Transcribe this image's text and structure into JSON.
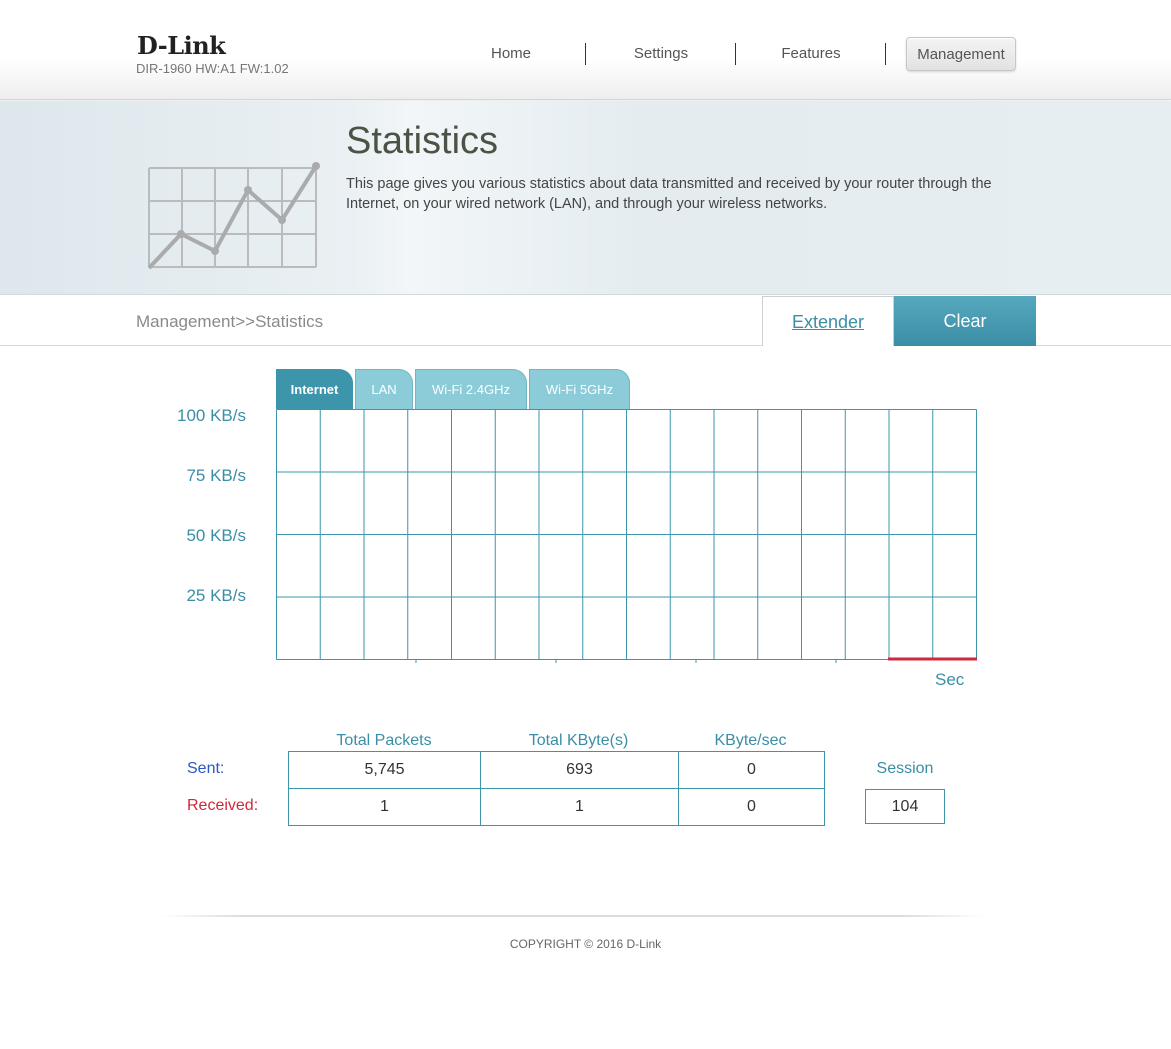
{
  "header": {
    "logo": "D-Link",
    "model": "DIR-1960 HW:A1 FW:1.02",
    "nav": [
      "Home",
      "Settings",
      "Features",
      "Management"
    ],
    "active_nav": "Management"
  },
  "banner": {
    "title": "Statistics",
    "description": "This page gives you various statistics about data transmitted and received by your router through the Internet, on your wired network (LAN), and through your wireless networks.",
    "icon": "line-chart-illustration"
  },
  "breadcrumb": "Management>>Statistics",
  "buttons": {
    "extender": "Extender",
    "clear": "Clear"
  },
  "tabs": [
    "Internet",
    "LAN",
    "Wi-Fi 2.4GHz",
    "Wi-Fi 5GHz"
  ],
  "active_tab": "Internet",
  "graph": {
    "y_labels": [
      "100 KB/s",
      "75 KB/s",
      "50 KB/s",
      "25 KB/s"
    ],
    "x_label": "Sec",
    "grid_color": "#3d95ab",
    "sent_color": "#2b59c3",
    "received_color": "#d1283b",
    "received_trace": "flat at 0 KB/s over the last two intervals"
  },
  "stats": {
    "columns": [
      "Total Packets",
      "Total KByte(s)",
      "KByte/sec"
    ],
    "sent_label": "Sent:",
    "received_label": "Received:",
    "sent": [
      "5,745",
      "693",
      "0"
    ],
    "received": [
      "1",
      "1",
      "0"
    ],
    "session_label": "Session",
    "session_value": "104"
  },
  "footer": {
    "copyright": "COPYRIGHT © 2016 D-Link"
  },
  "colors": {
    "accent": "#3d95ab",
    "tab_inactive": "#8ccbd8"
  }
}
